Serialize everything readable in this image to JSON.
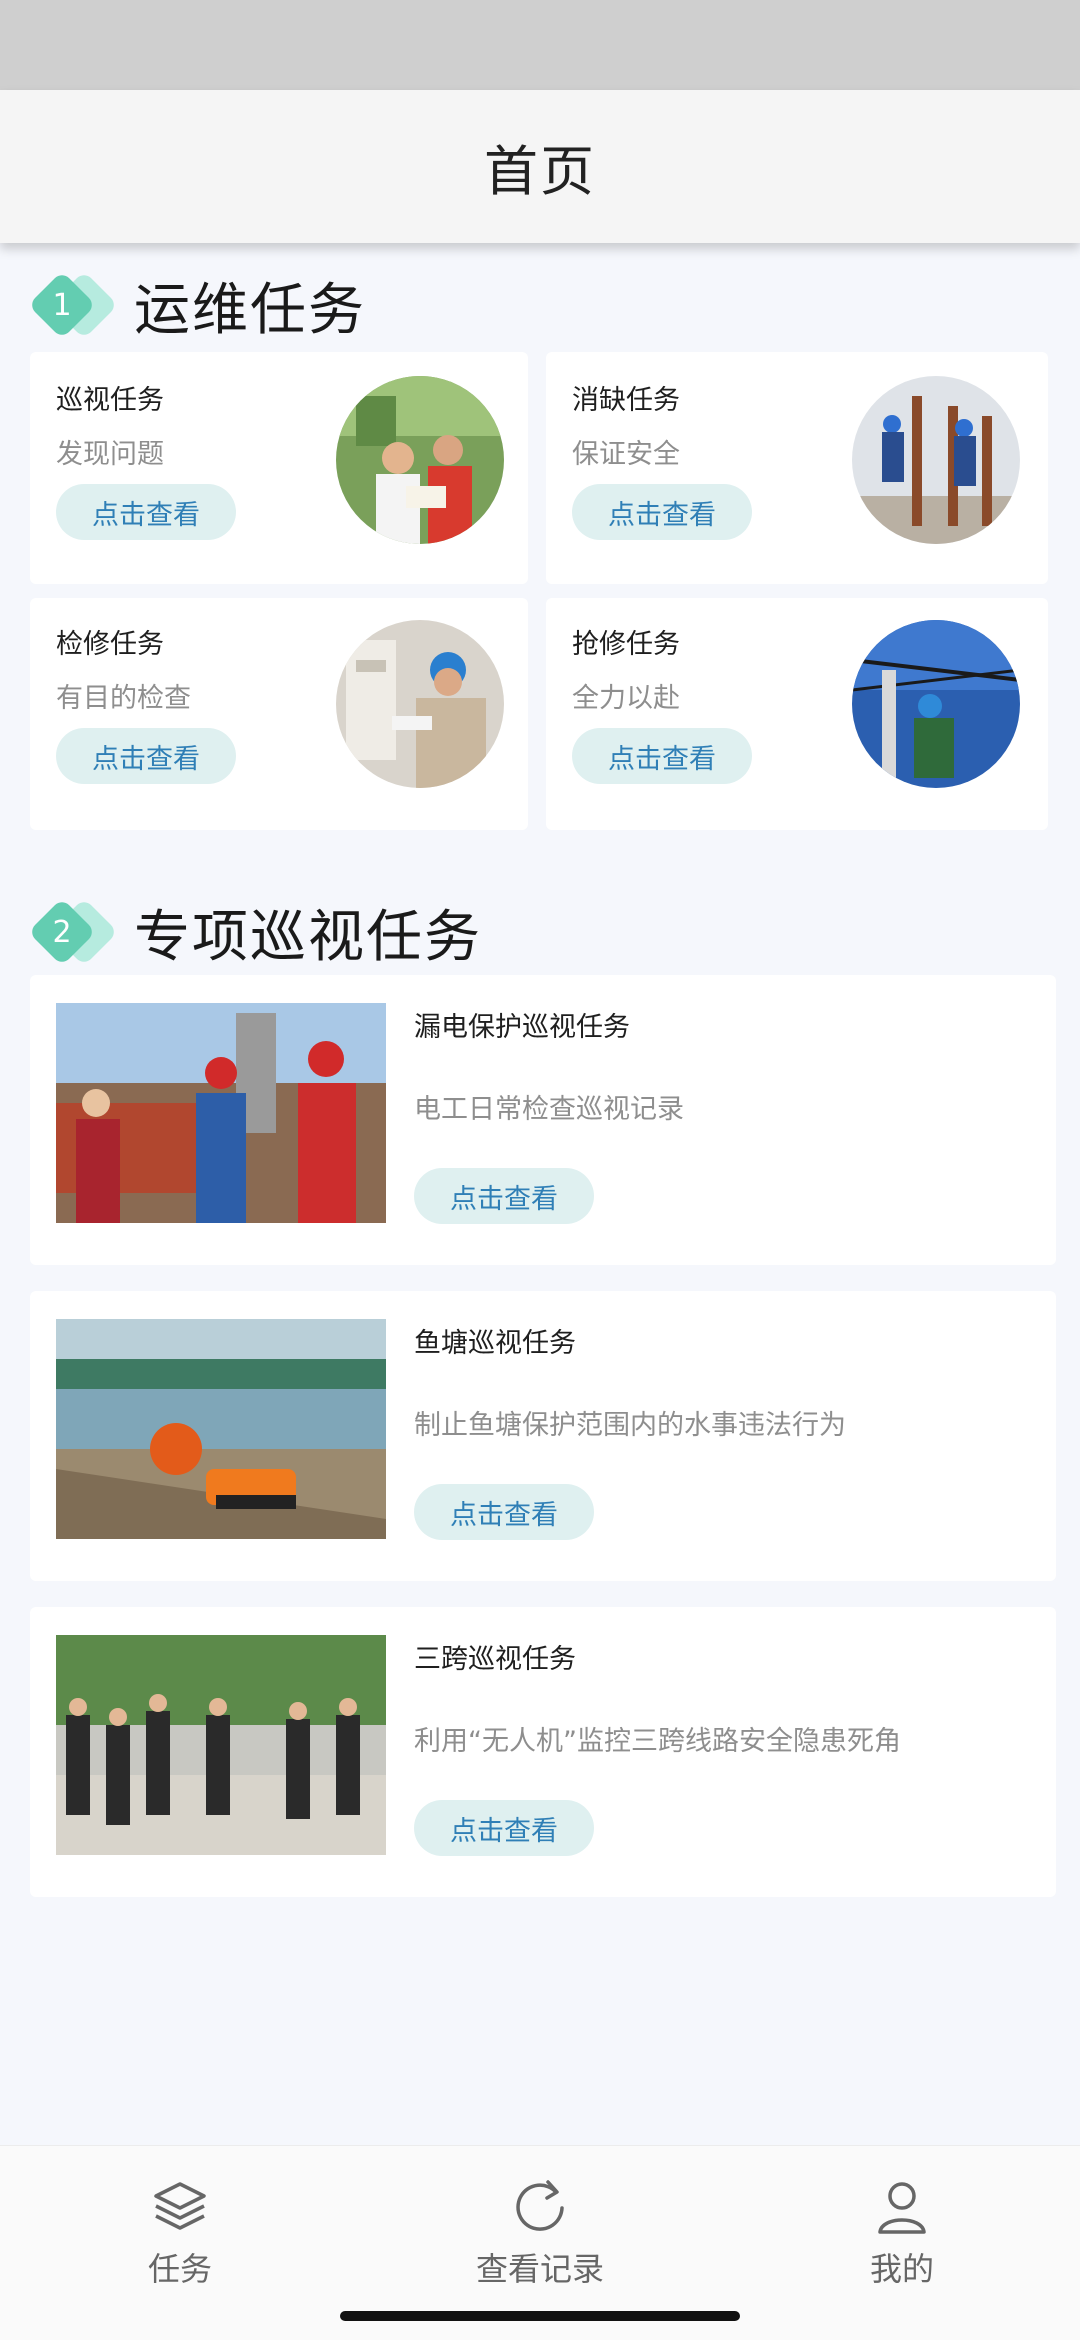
{
  "header": {
    "title": "首页"
  },
  "sections": [
    {
      "number": "1",
      "title": "运维任务",
      "cards": [
        {
          "title": "巡视任务",
          "subtitle": "发现问题",
          "button": "点击查看"
        },
        {
          "title": "消缺任务",
          "subtitle": "保证安全",
          "button": "点击查看"
        },
        {
          "title": "检修任务",
          "subtitle": "有目的检查",
          "button": "点击查看"
        },
        {
          "title": "抢修任务",
          "subtitle": "全力以赴",
          "button": "点击查看"
        }
      ]
    },
    {
      "number": "2",
      "title": "专项巡视任务",
      "cards": [
        {
          "title": "漏电保护巡视任务",
          "subtitle": "电工日常检查巡视记录",
          "button": "点击查看"
        },
        {
          "title": "鱼塘巡视任务",
          "subtitle": "制止鱼塘保护范围内的水事违法行为",
          "button": "点击查看"
        },
        {
          "title": "三跨巡视任务",
          "subtitle": "利用“无人机”监控三跨线路安全隐患死角",
          "button": "点击查看"
        }
      ]
    }
  ],
  "tabbar": {
    "items": [
      {
        "label": "任务",
        "icon": "layers-icon"
      },
      {
        "label": "查看记录",
        "icon": "refresh-icon"
      },
      {
        "label": "我的",
        "icon": "user-icon"
      }
    ]
  },
  "colors": {
    "accent": "#63cdb1",
    "button_bg": "#dff0f0",
    "button_text": "#2f7fb6",
    "page_bg": "#f5f7fc"
  }
}
